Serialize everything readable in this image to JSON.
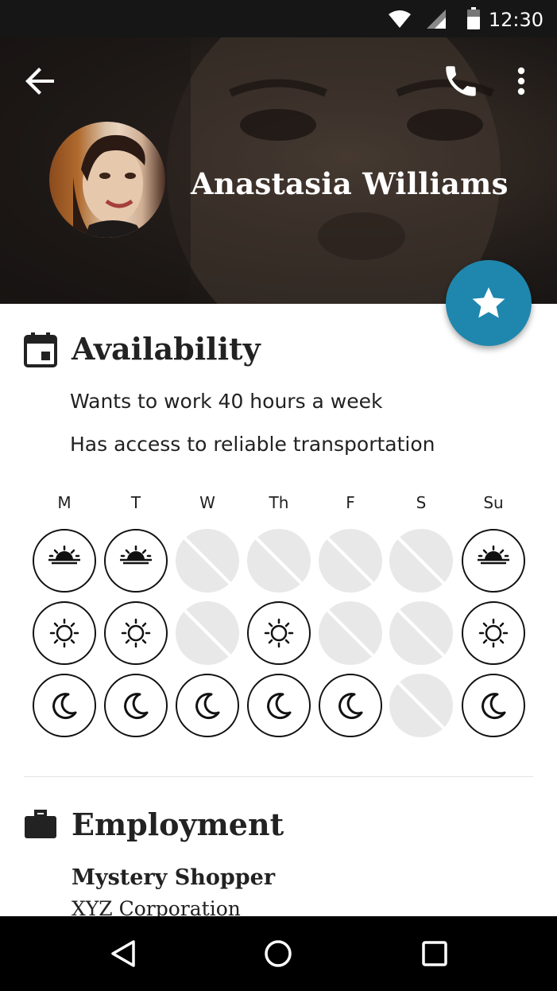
{
  "status_bar": {
    "time": "12:30",
    "icons": [
      "wifi-icon",
      "signal-icon",
      "battery-icon"
    ]
  },
  "header": {
    "name": "Anastasia Williams",
    "icons": {
      "back": "arrow-back-icon",
      "call": "phone-icon",
      "more": "more-vert-icon",
      "favorite": "star-icon"
    }
  },
  "colors": {
    "accent": "#1f87ad",
    "status_bar": "#161616",
    "nav_bar": "#000000",
    "off_slot": "#e8e8e8"
  },
  "availability": {
    "title": "Availability",
    "icon": "calendar-icon",
    "lines": [
      "Wants to work 40 hours a week",
      "Has access to reliable transportation"
    ],
    "days": [
      "M",
      "T",
      "W",
      "Th",
      "F",
      "S",
      "Su"
    ],
    "rows": [
      {
        "period": "morning",
        "icon": "sunrise-icon",
        "available": [
          true,
          true,
          false,
          false,
          false,
          false,
          true
        ]
      },
      {
        "period": "day",
        "icon": "sun-icon",
        "available": [
          true,
          true,
          false,
          true,
          false,
          false,
          true
        ]
      },
      {
        "period": "night",
        "icon": "moon-icon",
        "available": [
          true,
          true,
          true,
          true,
          true,
          false,
          true
        ]
      }
    ]
  },
  "employment": {
    "title": "Employment",
    "icon": "briefcase-icon",
    "job_title": "Mystery Shopper",
    "company": "XYZ Corporation"
  },
  "nav_bar": {
    "icons": [
      "back-triangle-icon",
      "home-circle-icon",
      "recents-square-icon"
    ]
  }
}
